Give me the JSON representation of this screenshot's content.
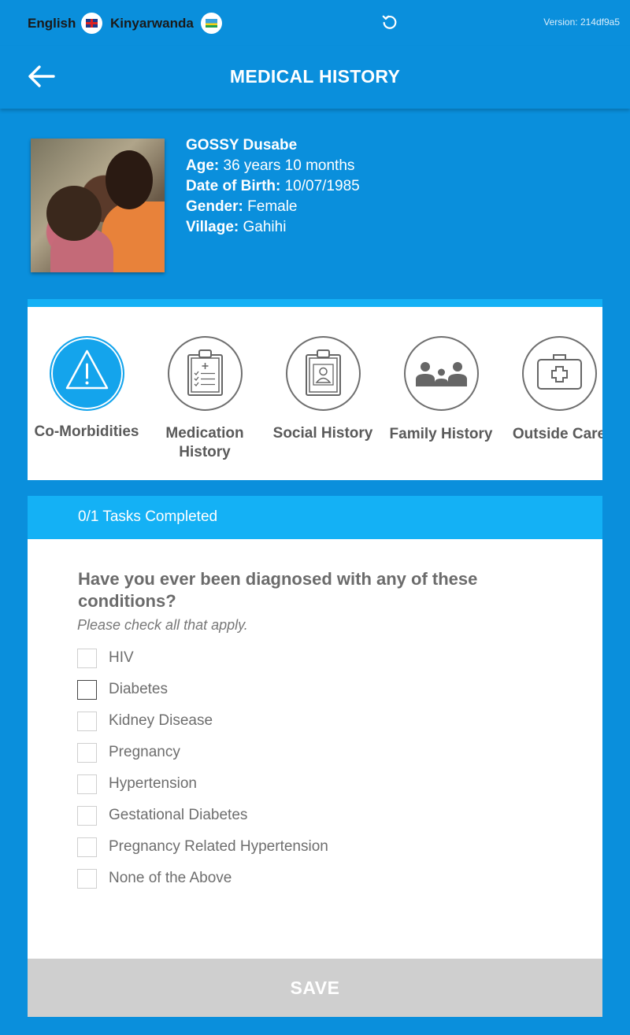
{
  "langbar": {
    "english": "English",
    "kinyarwanda": "Kinyarwanda",
    "version": "Version: 214df9a5"
  },
  "header": {
    "title": "MEDICAL HISTORY"
  },
  "patient": {
    "name": "GOSSY Dusabe",
    "age_label": "Age:",
    "age": "36 years 10 months",
    "dob_label": "Date of Birth:",
    "dob": "10/07/1985",
    "gender_label": "Gender:",
    "gender": "Female",
    "village_label": "Village:",
    "village": "Gahihi"
  },
  "tabs": [
    {
      "label": "Co-Morbidities",
      "icon": "warning-icon",
      "active": true
    },
    {
      "label": "Medication History",
      "icon": "clipboard-checklist-icon",
      "active": false
    },
    {
      "label": "Social History",
      "icon": "clipboard-person-icon",
      "active": false
    },
    {
      "label": "Family History",
      "icon": "family-icon",
      "active": false
    },
    {
      "label": "Outside Care",
      "icon": "medical-kit-icon",
      "active": false
    }
  ],
  "tasks": {
    "status": "0/1 Tasks Completed"
  },
  "form": {
    "question": "Have you ever been diagnosed with any of these conditions?",
    "hint": "Please check all that apply.",
    "options": [
      "HIV",
      "Diabetes",
      "Kidney Disease",
      "Pregnancy",
      "Hypertension",
      "Gestational Diabetes",
      "Pregnancy Related Hypertension",
      "None of the Above"
    ]
  },
  "save_label": "SAVE",
  "colors": {
    "primary": "#0a8fdc",
    "accent": "#14b1f5",
    "active_tab": "#14a4ec",
    "save_disabled": "#cfcfcf"
  }
}
